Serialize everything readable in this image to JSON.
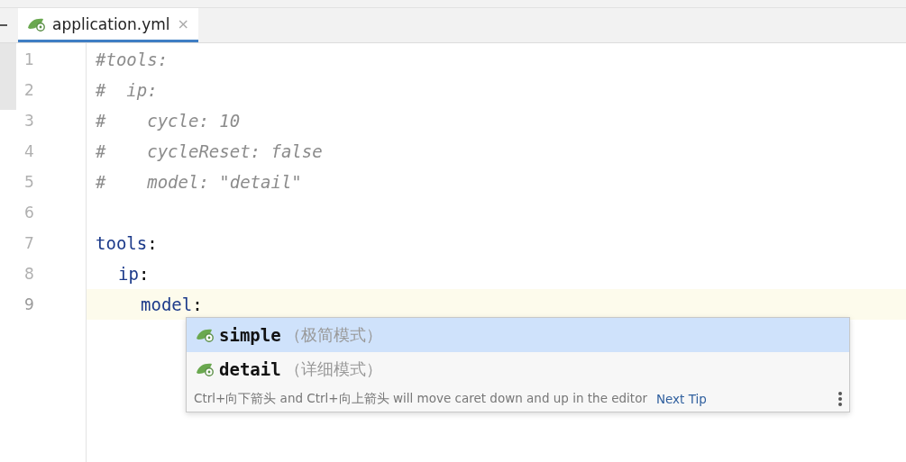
{
  "tab": {
    "label": "application.yml",
    "close": "×",
    "selected": true
  },
  "lines": [
    {
      "number": "1",
      "text": "#tools:",
      "kind": "comment",
      "current": false
    },
    {
      "number": "2",
      "text": "#  ip:",
      "kind": "comment",
      "current": false
    },
    {
      "number": "3",
      "text": "#    cycle: 10",
      "kind": "comment",
      "current": false
    },
    {
      "number": "4",
      "text": "#    cycleReset: false",
      "kind": "comment",
      "current": false
    },
    {
      "number": "5",
      "text": "#    model: \"detail\"",
      "kind": "comment",
      "current": false
    },
    {
      "number": "6",
      "kind": "blank",
      "current": false
    },
    {
      "number": "7",
      "text": "tools",
      "sep": ":",
      "kind": "key",
      "current": false,
      "children": [
        {
          "number": "8",
          "text": "ip",
          "sep": ":",
          "kind": "key",
          "current": false,
          "children": [
            {
              "number": "9",
              "text": "model",
              "sep": ":",
              "kind": "key",
              "current": true
            }
          ]
        }
      ]
    }
  ],
  "completion": {
    "items": [
      {
        "label": "simple",
        "hint": "（极简模式）",
        "selected": true
      },
      {
        "label": "detail",
        "hint": "（详细模式）",
        "selected": false
      }
    ],
    "tip": "Ctrl+向下箭头 and Ctrl+向上箭头 will move caret down and up in the editor",
    "next_tip": "Next Tip"
  }
}
